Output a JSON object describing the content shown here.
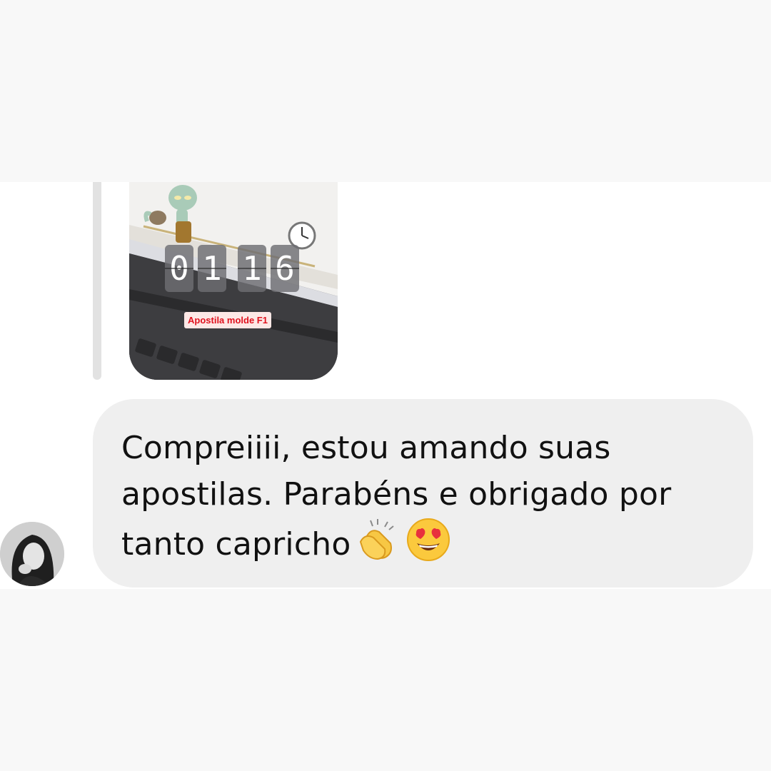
{
  "story_reply": {
    "counter_digits": [
      "0",
      "1",
      "1",
      "6"
    ],
    "tag_text": "Apostila molde F1",
    "decorations": [
      "squidward-sticker",
      "clock-icon",
      "laptop-keyboard-photo"
    ]
  },
  "message": {
    "text": "Compreiiii, estou amando suas apostilas. Parabéns e obrigado por tanto capricho",
    "emojis": [
      "clapping-hands-icon",
      "heart-eyes-face-icon"
    ]
  },
  "colors": {
    "background": "#f8f8f8",
    "chat_background": "#ffffff",
    "bubble": "#efefef",
    "tag_text": "#e0121e",
    "tag_background": "#fde8e6"
  }
}
